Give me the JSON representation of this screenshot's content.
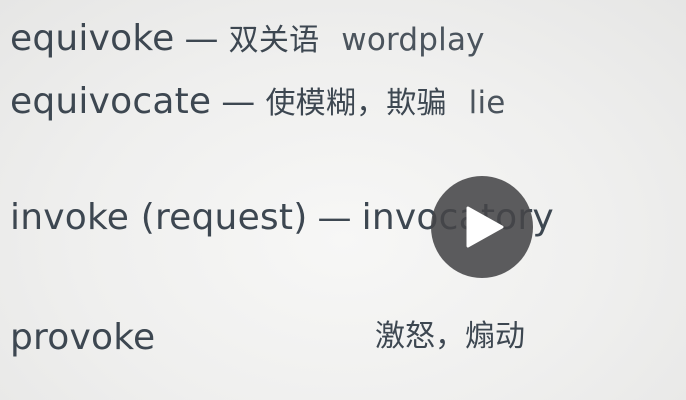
{
  "slide": {
    "rows": [
      {
        "word": "equivoke",
        "dash": "—",
        "chinese": "双关语",
        "gloss": "wordplay"
      },
      {
        "word": "equivocate",
        "dash": "—",
        "chinese": "使模糊，欺骗",
        "gloss": "lie"
      },
      {
        "word": "invoke (request)",
        "dash": "—",
        "derived": "invocatory"
      },
      {
        "word": "provoke",
        "chinese": "激怒，煽动"
      }
    ]
  },
  "player": {
    "play_icon": "play-icon",
    "overlay_color": "#464648"
  }
}
